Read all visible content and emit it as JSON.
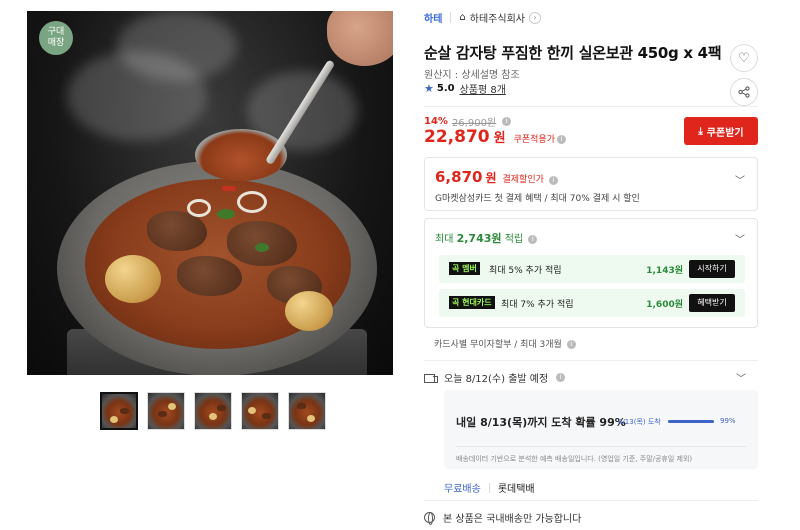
{
  "gallery": {
    "badge": "구대\n매장",
    "thumbnails": [
      {
        "alt": "thumbnail-1",
        "active": true
      },
      {
        "alt": "thumbnail-2",
        "active": false
      },
      {
        "alt": "thumbnail-3",
        "active": false
      },
      {
        "alt": "thumbnail-4",
        "active": false
      },
      {
        "alt": "thumbnail-5",
        "active": false
      }
    ]
  },
  "header": {
    "brand": "하테",
    "store": "하테주식회사"
  },
  "product": {
    "title": "순살 감자탕 푸짐한 한끼 실온보관 450g x 4팩",
    "origin": "원산지 : 상세설명 참조",
    "rating": "5.0",
    "reviews": "상품평 8개"
  },
  "price": {
    "discount_rate": "14%",
    "original": "26,900원",
    "sale": "22,870",
    "won": "원",
    "coupon_applied": "쿠폰적용가",
    "coupon_button": "쿠폰받기"
  },
  "card_discount": {
    "price": "6,870",
    "won": "원",
    "label": "결제할인가",
    "desc": "G마켓삼성카드 첫 결제 혜택 / 최대 70% 결제 시 할인"
  },
  "rewards": {
    "head_prefix": "최대",
    "head_amount": "2,743원",
    "head_suffix": "적립",
    "items": [
      {
        "tag": "곡 멤버",
        "text": "최대 5% 추가 적립",
        "amount": "1,143원",
        "button": "시작하기"
      },
      {
        "tag": "곡 현대카드",
        "text": "최대 7% 추가 적립",
        "amount": "1,600원",
        "button": "혜택받기"
      }
    ]
  },
  "installment": "카드사별 무이자할부 / 최대 3개월",
  "shipping": {
    "dispatch": "오늘 8/12(수) 출발 예정",
    "eta_main": "내일 8/13(목)까지 도착 확률 99%",
    "eta_mini": "8/13(목) 도착",
    "eta_pct": "99%",
    "eta_progress": 0.99,
    "eta_note": "배송데이터 기반으로 분석한 예측 배송일입니다. (영업일 기준, 주말/공휴일 제외)",
    "free": "무료배송",
    "carrier": "롯데택배",
    "domestic": "본 상품은 국내배송만 가능합니다"
  },
  "colors": {
    "accent_red": "#e0251c",
    "accent_blue": "#3e64c8",
    "accent_green": "#2a8a3a"
  }
}
